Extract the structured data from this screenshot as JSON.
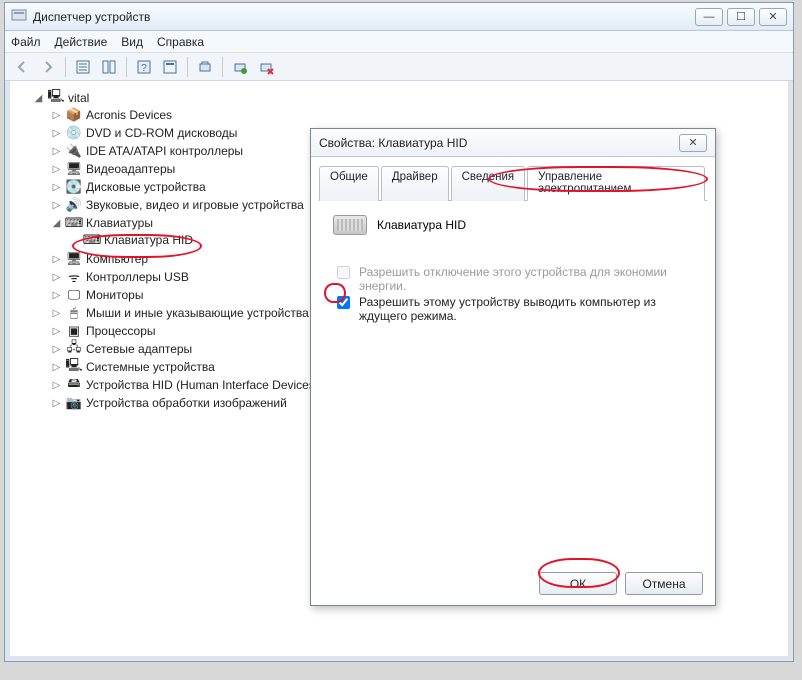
{
  "main": {
    "title": "Диспетчер устройств",
    "menu": {
      "file": "Файл",
      "action": "Действие",
      "view": "Вид",
      "help": "Справка"
    }
  },
  "tree": {
    "root": "vital",
    "items": [
      {
        "label": "Acronis Devices",
        "icon": "📦"
      },
      {
        "label": "DVD и CD-ROM дисководы",
        "icon": "💿"
      },
      {
        "label": "IDE ATA/ATAPI контроллеры",
        "icon": "🔌"
      },
      {
        "label": "Видеоадаптеры",
        "icon": "🖥"
      },
      {
        "label": "Дисковые устройства",
        "icon": "💽"
      },
      {
        "label": "Звуковые, видео и игровые устройства",
        "icon": "🔊"
      },
      {
        "label": "Клавиатуры",
        "icon": "⌨",
        "expanded": true,
        "children": [
          {
            "label": "Клавиатура HID",
            "icon": "⌨"
          }
        ]
      },
      {
        "label": "Компьютер",
        "icon": "🖥"
      },
      {
        "label": "Контроллеры USB",
        "icon": "ᯤ"
      },
      {
        "label": "Мониторы",
        "icon": "🖵"
      },
      {
        "label": "Мыши и иные указывающие устройства",
        "icon": "🖱"
      },
      {
        "label": "Процессоры",
        "icon": "▣"
      },
      {
        "label": "Сетевые адаптеры",
        "icon": "🖧"
      },
      {
        "label": "Системные устройства",
        "icon": "🖳"
      },
      {
        "label": "Устройства HID (Human Interface Devices)",
        "icon": "🖴"
      },
      {
        "label": "Устройства обработки изображений",
        "icon": "📷"
      }
    ]
  },
  "dialog": {
    "title": "Свойства: Клавиатура HID",
    "tabs": {
      "general": "Общие",
      "driver": "Драйвер",
      "details": "Сведения",
      "power": "Управление электропитанием"
    },
    "device_name": "Клавиатура HID",
    "chk1": "Разрешить отключение этого устройства для экономии энергии.",
    "chk2": "Разрешить этому устройству выводить компьютер из ждущего режима.",
    "ok": "ОК",
    "cancel": "Отмена"
  }
}
